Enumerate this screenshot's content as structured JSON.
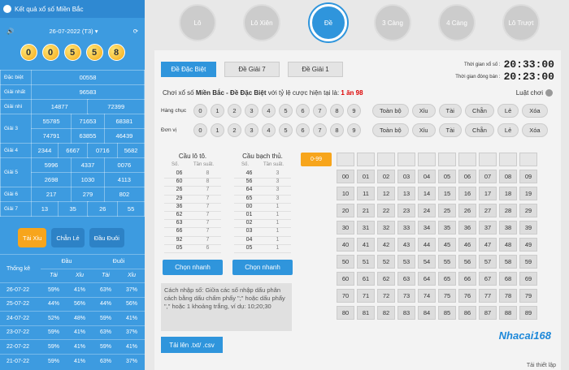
{
  "left": {
    "title": "Kết quả xổ số Miền Bắc",
    "date": "26-07-2022 (T3)",
    "balls": [
      "0",
      "0",
      "5",
      "5",
      "8"
    ],
    "prizes": [
      {
        "label": "Đặc biệt",
        "vals": [
          "00558"
        ]
      },
      {
        "label": "Giải nhất",
        "vals": [
          "96583"
        ]
      },
      {
        "label": "Giải nhì",
        "vals": [
          "14877",
          "72399"
        ]
      },
      {
        "label": "Giải 3",
        "vals": [
          "55785",
          "71653",
          "68381",
          "74791",
          "63855",
          "46439"
        ]
      },
      {
        "label": "Giải 4",
        "vals": [
          "2344",
          "6667",
          "0716",
          "5682"
        ]
      },
      {
        "label": "Giải 5",
        "vals": [
          "5996",
          "4337",
          "0076",
          "2698",
          "1030",
          "4113"
        ]
      },
      {
        "label": "Giải 6",
        "vals": [
          "217",
          "279",
          "802"
        ]
      },
      {
        "label": "Giải 7",
        "vals": [
          "13",
          "35",
          "26",
          "55"
        ]
      }
    ],
    "buttons": [
      "Tài Xỉu",
      "Chẵn Lẻ",
      "Đầu Đuôi"
    ],
    "stats": {
      "title": "Thống kê",
      "head_dau": "Đầu",
      "head_duoi": "Đuôi",
      "tai": "Tài",
      "xiu": "Xỉu",
      "rows": [
        [
          "26-07-22",
          "59%",
          "41%",
          "63%",
          "37%"
        ],
        [
          "25-07-22",
          "44%",
          "56%",
          "44%",
          "56%"
        ],
        [
          "24-07-22",
          "52%",
          "48%",
          "59%",
          "41%"
        ],
        [
          "23-07-22",
          "59%",
          "41%",
          "63%",
          "37%"
        ],
        [
          "22-07-22",
          "59%",
          "41%",
          "59%",
          "41%"
        ],
        [
          "21-07-22",
          "59%",
          "41%",
          "63%",
          "37%"
        ]
      ]
    }
  },
  "circles": [
    "Lô",
    "Lô Xiên",
    "Đề",
    "3 Càng",
    "4 Càng",
    "Lô Trượt"
  ],
  "tabs": [
    "Đề Đặc Biệt",
    "Đề Giải 7",
    "Đề Giải 1"
  ],
  "timer": {
    "draw_label": "Thời gian xổ số :",
    "draw": "20:33:00",
    "close_label": "Thời gian đóng bán :",
    "close": "20:23:00"
  },
  "info": {
    "prefix": "Chơi xổ số ",
    "bold": "Miền Bắc - Đề Đặc Biệt",
    "suffix": " với tỷ lệ cược hiện tại là: ",
    "red": "1 ăn 98"
  },
  "rule_label": "Luật chơi",
  "row_labels": [
    "Hàng chục",
    "Đơn vị"
  ],
  "digits": [
    "0",
    "1",
    "2",
    "3",
    "4",
    "5",
    "6",
    "7",
    "8",
    "9"
  ],
  "actions": [
    "Toàn bộ",
    "Xỉu",
    "Tài",
    "Chẵn",
    "Lẻ",
    "Xóa"
  ],
  "lo": {
    "title": "Cầu lô tô.",
    "h1": "Số.",
    "h2": "Tần suất.",
    "rows": [
      [
        "06",
        "8"
      ],
      [
        "60",
        "8"
      ],
      [
        "26",
        "7"
      ],
      [
        "29",
        "7"
      ],
      [
        "36",
        "7"
      ],
      [
        "62",
        "7"
      ],
      [
        "63",
        "7"
      ],
      [
        "66",
        "7"
      ],
      [
        "92",
        "7"
      ],
      [
        "05",
        "6"
      ]
    ]
  },
  "bach": {
    "title": "Cầu bạch thủ.",
    "h1": "Số.",
    "h2": "Tần suất.",
    "rows": [
      [
        "46",
        "3"
      ],
      [
        "56",
        "3"
      ],
      [
        "64",
        "3"
      ],
      [
        "65",
        "3"
      ],
      [
        "00",
        "1"
      ],
      [
        "01",
        "1"
      ],
      [
        "02",
        "1"
      ],
      [
        "03",
        "1"
      ],
      [
        "04",
        "1"
      ],
      [
        "05",
        "1"
      ]
    ]
  },
  "quick": "Chọn nhanh",
  "help": "Cách nhập số: Giữa các số nhập dấu phân cách bằng dấu chấm phẩy \";\" hoặc dấu phẩy \",\" hoặc 1 khoảng trắng, ví dụ: 10;20;30",
  "upload": "Tải lên .txt/ .csv",
  "range": "0-99",
  "grid": [
    "00",
    "01",
    "02",
    "03",
    "04",
    "05",
    "06",
    "07",
    "08",
    "09",
    "10",
    "11",
    "12",
    "13",
    "14",
    "15",
    "16",
    "17",
    "18",
    "19",
    "20",
    "21",
    "22",
    "23",
    "24",
    "25",
    "26",
    "27",
    "28",
    "29",
    "30",
    "31",
    "32",
    "33",
    "34",
    "35",
    "36",
    "37",
    "38",
    "39",
    "40",
    "41",
    "42",
    "43",
    "44",
    "45",
    "46",
    "47",
    "48",
    "49",
    "50",
    "51",
    "52",
    "53",
    "54",
    "55",
    "56",
    "57",
    "58",
    "59",
    "60",
    "61",
    "62",
    "63",
    "64",
    "65",
    "66",
    "67",
    "68",
    "69",
    "70",
    "71",
    "72",
    "73",
    "74",
    "75",
    "76",
    "77",
    "78",
    "79",
    "80",
    "81",
    "82",
    "83",
    "84",
    "85",
    "86",
    "87",
    "88",
    "89"
  ],
  "logo": "Nhacai168",
  "setup": "Tải thiết lập"
}
